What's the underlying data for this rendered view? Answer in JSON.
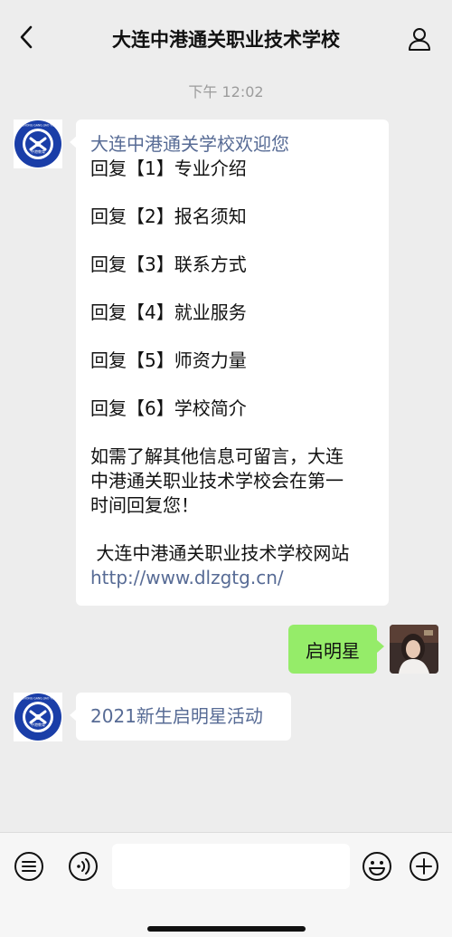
{
  "header": {
    "title": "大连中港通关职业技术学校"
  },
  "timestamp": "下午 12:02",
  "messages": {
    "menu": {
      "welcome": "大连中港通关学校欢迎您",
      "options": [
        "回复【1】专业介绍",
        "回复【2】报名须知",
        "回复【3】联系方式",
        "回复【4】就业服务",
        "回复【5】师资力量",
        "回复【6】学校简介"
      ],
      "note_lines": [
        "如需了解其他信息可留言，大连",
        "中港通关职业技术学校会在第一",
        "时间回复您！"
      ],
      "site_name": " 大连中港通关职业技术学校网站",
      "site_url": "http://www.dlzgtg.cn/"
    },
    "user_reply": "启明星",
    "event": "2021新生启明星活动"
  },
  "logo": {
    "text_top": "ZHONG GANG JIAO YU",
    "text_bottom": "中港教育"
  },
  "colors": {
    "background": "#ededed",
    "link": "#576b95",
    "own_bubble": "#95ec69",
    "logo_blue": "#1a3ea8"
  }
}
